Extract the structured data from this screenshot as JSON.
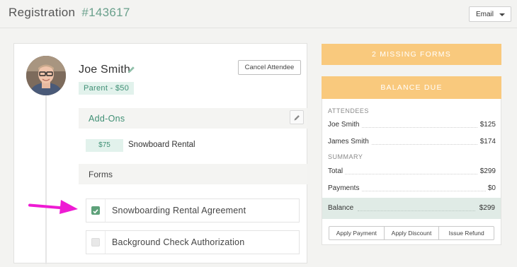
{
  "header": {
    "title": "Registration",
    "registration_id": "#143617",
    "email_button": "Email"
  },
  "attendee": {
    "name": "Joe Smith",
    "role_badge": "Parent - $50",
    "cancel_button": "Cancel Attendee"
  },
  "addons": {
    "title": "Add-Ons",
    "items": [
      {
        "price": "$75",
        "label": "Snowboard Rental"
      }
    ]
  },
  "forms": {
    "title": "Forms",
    "items": [
      {
        "label": "Snowboarding Rental Agreement",
        "checked": true
      },
      {
        "label": "Background Check Authorization",
        "checked": false
      }
    ]
  },
  "sidebar": {
    "missing_forms": "2 MISSING FORMS",
    "balance_header": "BALANCE DUE",
    "attendees_label": "ATTENDEES",
    "attendees": [
      {
        "name": "Joe Smith",
        "amount": "$125"
      },
      {
        "name": "James Smith",
        "amount": "$174"
      }
    ],
    "summary_label": "SUMMARY",
    "summary": [
      {
        "label": "Total",
        "amount": "$299"
      },
      {
        "label": "Payments",
        "amount": "$0"
      }
    ],
    "balance": {
      "label": "Balance",
      "amount": "$299"
    },
    "buttons": [
      "Apply Payment",
      "Apply Discount",
      "Issue Refund"
    ]
  },
  "colors": {
    "accent_green": "#3f8f74",
    "banner_orange": "#f9c97d",
    "annotation_arrow": "#ee1bd3"
  }
}
